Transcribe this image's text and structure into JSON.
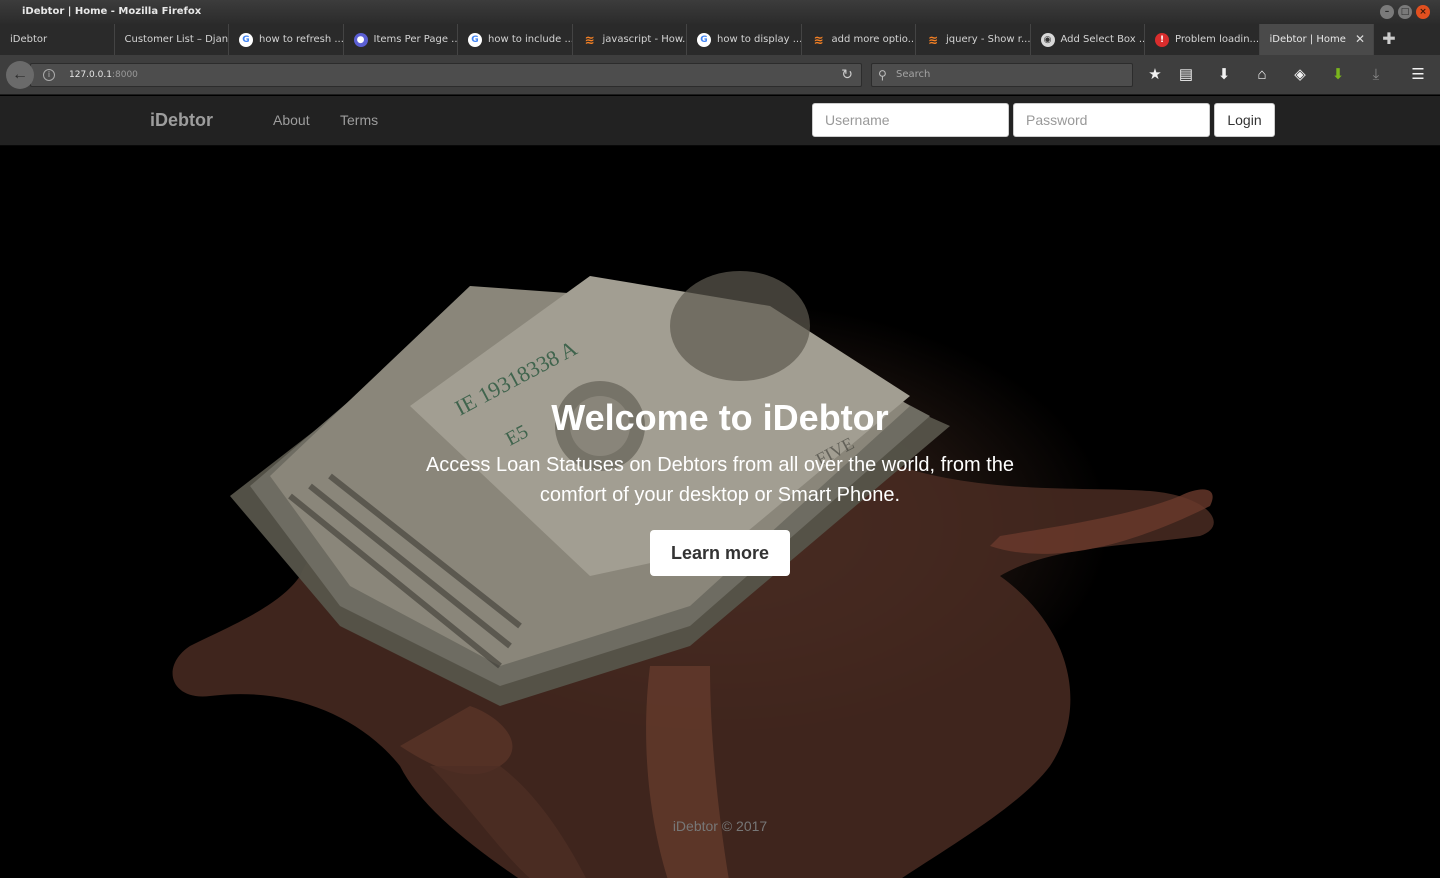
{
  "window": {
    "title": "iDebtor | Home - Mozilla Firefox"
  },
  "tabs": [
    {
      "label": "iDebtor",
      "icon": "none"
    },
    {
      "label": "Customer List – Djan...",
      "icon": "none"
    },
    {
      "label": "how to refresh ...",
      "icon": "google-icon"
    },
    {
      "label": "Items Per Page ...",
      "icon": "blue-circle-icon"
    },
    {
      "label": "how to include ...",
      "icon": "google-icon"
    },
    {
      "label": "javascript - How...",
      "icon": "stackoverflow-icon"
    },
    {
      "label": "how to display ...",
      "icon": "google-icon"
    },
    {
      "label": "add more optio...",
      "icon": "stackoverflow-icon"
    },
    {
      "label": "jquery - Show r...",
      "icon": "stackoverflow-icon"
    },
    {
      "label": "Add Select Box ...",
      "icon": "github-icon"
    },
    {
      "label": "Problem loadin...",
      "icon": "error-icon"
    },
    {
      "label": "iDebtor | Home",
      "icon": "none",
      "active": true
    }
  ],
  "navbar": {
    "url_host": "127.0.0.1",
    "url_port": ":8000",
    "search_placeholder": "Search"
  },
  "site": {
    "brand": "iDebtor",
    "nav_links": [
      "About",
      "Terms"
    ],
    "username_placeholder": "Username",
    "password_placeholder": "Password",
    "login_label": "Login"
  },
  "hero": {
    "title": "Welcome to iDebtor",
    "subtitle": "Access Loan Statuses on Debtors from all over the world, from the comfort of your desktop or Smart Phone.",
    "button_label": "Learn more"
  },
  "footer": {
    "text": "iDebtor © 2017"
  },
  "colors": {
    "site_nav_bg": "#222222",
    "nav_text": "#9d9d9d",
    "hero_text": "#ffffff"
  }
}
